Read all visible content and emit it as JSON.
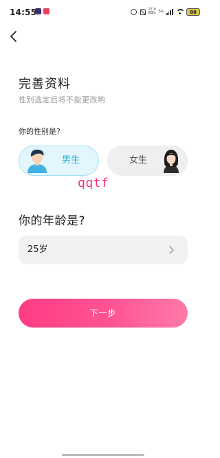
{
  "status_bar": {
    "time": "14:55",
    "net_speed_value": "27.9",
    "net_speed_unit": "KB/s",
    "network_type": "5G",
    "battery": "88",
    "icons": [
      "alarm-icon",
      "mute-icon",
      "signal-icon",
      "wifi-icon",
      "battery-icon"
    ]
  },
  "header": {
    "back_icon": "chevron-left-icon",
    "title": "完善资料",
    "subtitle": "性别选定后将不能更改哟"
  },
  "gender": {
    "question": "你的性别是?",
    "options": [
      {
        "label": "男生",
        "selected": true,
        "icon": "male-avatar-icon"
      },
      {
        "label": "女生",
        "selected": false,
        "icon": "female-avatar-icon"
      }
    ]
  },
  "overlay_text": "qqtf",
  "age": {
    "question": "你的年龄是?",
    "value": "25岁",
    "icon": "chevron-right-icon"
  },
  "actions": {
    "next_label": "下一步"
  },
  "colors": {
    "accent_pink": "#ff4d8d",
    "selected_blue": "#2ab2d4",
    "selected_bg": "#e4f6fd",
    "overlay_text": "#ff2f73"
  }
}
